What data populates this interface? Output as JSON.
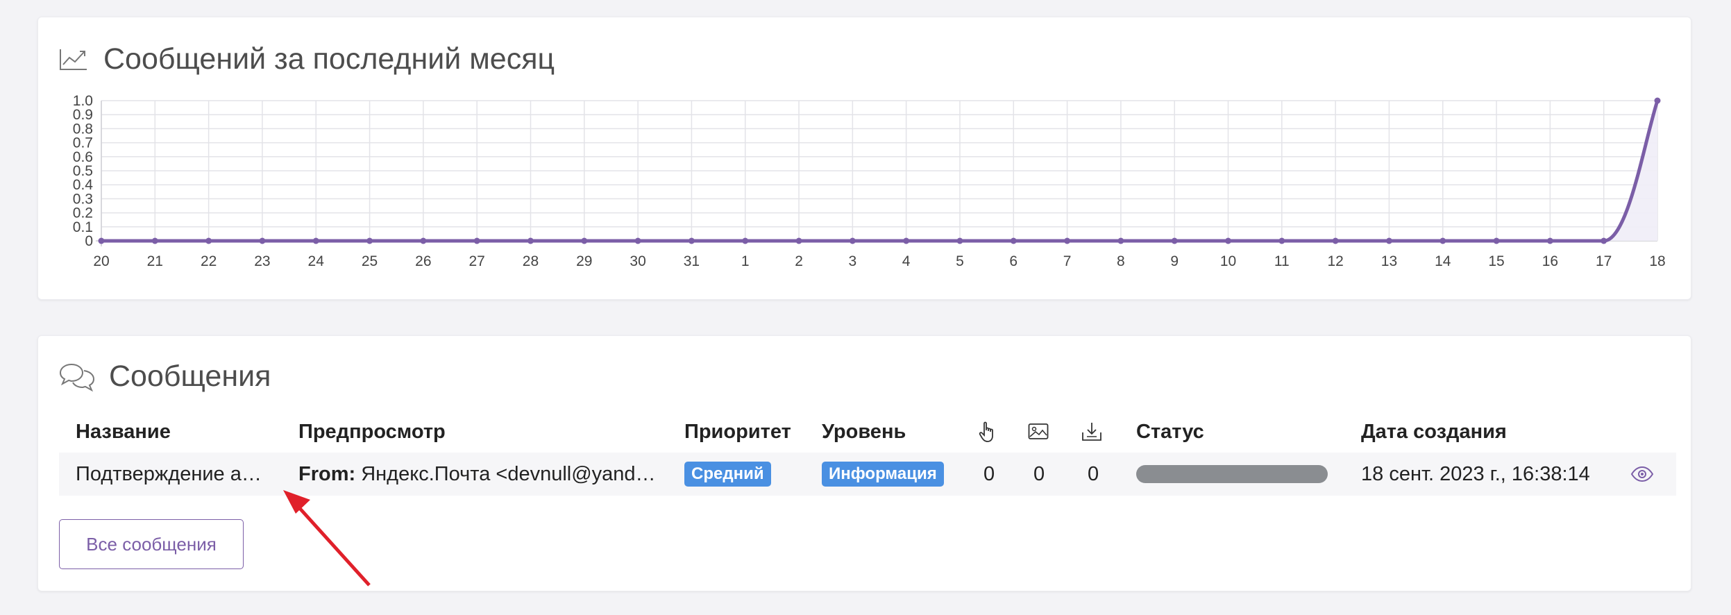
{
  "chart_panel": {
    "title": "Сообщений за последний месяц",
    "icon": "trend-chart-icon"
  },
  "chart_data": {
    "type": "area",
    "title": "Сообщений за последний месяц",
    "xlabel": "",
    "ylabel": "",
    "ylim": [
      0,
      1.0
    ],
    "yticks": [
      "0",
      "0.1",
      "0.2",
      "0.3",
      "0.4",
      "0.5",
      "0.6",
      "0.7",
      "0.8",
      "0.9",
      "1.0"
    ],
    "categories": [
      "20",
      "21",
      "22",
      "23",
      "24",
      "25",
      "26",
      "27",
      "28",
      "29",
      "30",
      "31",
      "1",
      "2",
      "3",
      "4",
      "5",
      "6",
      "7",
      "8",
      "9",
      "10",
      "11",
      "12",
      "13",
      "14",
      "15",
      "16",
      "17",
      "18"
    ],
    "series": [
      {
        "values": [
          0,
          0,
          0,
          0,
          0,
          0,
          0,
          0,
          0,
          0,
          0,
          0,
          0,
          0,
          0,
          0,
          0,
          0,
          0,
          0,
          0,
          0,
          0,
          0,
          0,
          0,
          0,
          0,
          0,
          1
        ]
      }
    ],
    "grid": true,
    "colors": {
      "line": "#7b5ea7",
      "fill": "#efedf7",
      "grid": "#e3e3e8"
    }
  },
  "messages_panel": {
    "title": "Сообщения",
    "icon": "chat-bubbles-icon",
    "columns": {
      "name": "Название",
      "preview": "Предпросмотр",
      "priority": "Приоритет",
      "level": "Уровень",
      "clicks_icon": "pointer-hand-icon",
      "images_icon": "image-icon",
      "downloads_icon": "download-icon",
      "status": "Статус",
      "created": "Дата создания"
    },
    "rows": [
      {
        "name": "Подтверждение а…",
        "preview_from_label": "From:",
        "preview_text": " Яндекс.Почта <devnull@yand…",
        "priority": "Средний",
        "level": "Информация",
        "clicks": "0",
        "images": "0",
        "downloads": "0",
        "created": "18 сент. 2023 г., 16:38:14",
        "action_icon": "eye-icon"
      }
    ],
    "all_button": "Все сообщения"
  },
  "colors": {
    "accent": "#7b5ea7",
    "badge_blue": "#4a90e2",
    "status_gray": "#8a8d91",
    "annotation_red": "#e0202a"
  }
}
